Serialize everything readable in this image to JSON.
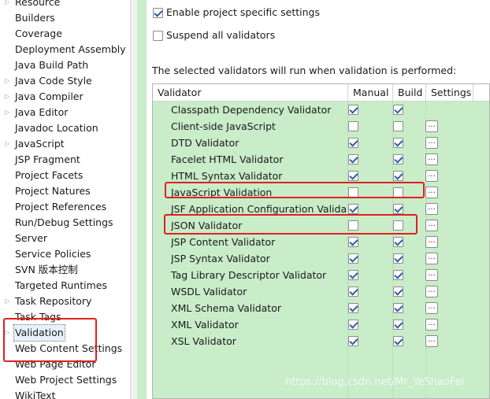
{
  "tree": {
    "items": [
      {
        "label": "Resource",
        "arrow": true
      },
      {
        "label": "Builders",
        "arrow": false
      },
      {
        "label": "Coverage",
        "arrow": false
      },
      {
        "label": "Deployment Assembly",
        "arrow": false
      },
      {
        "label": "Java Build Path",
        "arrow": false
      },
      {
        "label": "Java Code Style",
        "arrow": true
      },
      {
        "label": "Java Compiler",
        "arrow": true
      },
      {
        "label": "Java Editor",
        "arrow": true
      },
      {
        "label": "Javadoc Location",
        "arrow": false
      },
      {
        "label": "JavaScript",
        "arrow": true
      },
      {
        "label": "JSP Fragment",
        "arrow": false
      },
      {
        "label": "Project Facets",
        "arrow": false
      },
      {
        "label": "Project Natures",
        "arrow": false
      },
      {
        "label": "Project References",
        "arrow": false
      },
      {
        "label": "Run/Debug Settings",
        "arrow": false
      },
      {
        "label": "Server",
        "arrow": false
      },
      {
        "label": "Service Policies",
        "arrow": false
      },
      {
        "label": "SVN 版本控制",
        "arrow": false
      },
      {
        "label": "Targeted Runtimes",
        "arrow": false
      },
      {
        "label": "Task Repository",
        "arrow": true
      },
      {
        "label": "Task Tags",
        "arrow": false
      },
      {
        "label": "Validation",
        "arrow": true,
        "selected": true
      },
      {
        "label": "Web Content Settings",
        "arrow": false
      },
      {
        "label": "Web Page Editor",
        "arrow": false
      },
      {
        "label": "Web Project Settings",
        "arrow": false
      },
      {
        "label": "WikiText",
        "arrow": false
      }
    ]
  },
  "options": {
    "enable_label": "Enable project specific settings",
    "enable_checked": true,
    "suspend_label": "Suspend all validators",
    "suspend_checked": false
  },
  "intro_text": "The selected validators will run when validation is performed:",
  "table": {
    "headers": [
      "Validator",
      "Manual",
      "Build",
      "Settings"
    ],
    "settings_label": "...",
    "rows": [
      {
        "name": "Classpath Dependency Validator",
        "manual": true,
        "build": true,
        "settings": false
      },
      {
        "name": "Client-side JavaScript",
        "manual": false,
        "build": false,
        "settings": true
      },
      {
        "name": "DTD Validator",
        "manual": true,
        "build": true,
        "settings": true
      },
      {
        "name": "Facelet HTML Validator",
        "manual": true,
        "build": true,
        "settings": true
      },
      {
        "name": "HTML Syntax Validator",
        "manual": true,
        "build": true,
        "settings": true
      },
      {
        "name": "JavaScript Validation",
        "manual": false,
        "build": false,
        "settings": true
      },
      {
        "name": "JSF Application Configuration Valida...",
        "manual": true,
        "build": true,
        "settings": true
      },
      {
        "name": "JSON Validator",
        "manual": false,
        "build": false,
        "settings": true
      },
      {
        "name": "JSP Content Validator",
        "manual": true,
        "build": true,
        "settings": true
      },
      {
        "name": "JSP Syntax Validator",
        "manual": true,
        "build": true,
        "settings": true
      },
      {
        "name": "Tag Library Descriptor Validator",
        "manual": true,
        "build": true,
        "settings": true
      },
      {
        "name": "WSDL Validator",
        "manual": true,
        "build": true,
        "settings": true
      },
      {
        "name": "XML Schema Validator",
        "manual": true,
        "build": true,
        "settings": true
      },
      {
        "name": "XML Validator",
        "manual": true,
        "build": true,
        "settings": true
      },
      {
        "name": "XSL Validator",
        "manual": true,
        "build": true,
        "settings": true
      }
    ]
  },
  "watermark": "https://blog.csdn.net/Mr_YeShaoFei",
  "colors": {
    "accent_green": "#c9ecc9",
    "highlight_red": "#e02020",
    "check_blue": "#2f5f9e"
  }
}
